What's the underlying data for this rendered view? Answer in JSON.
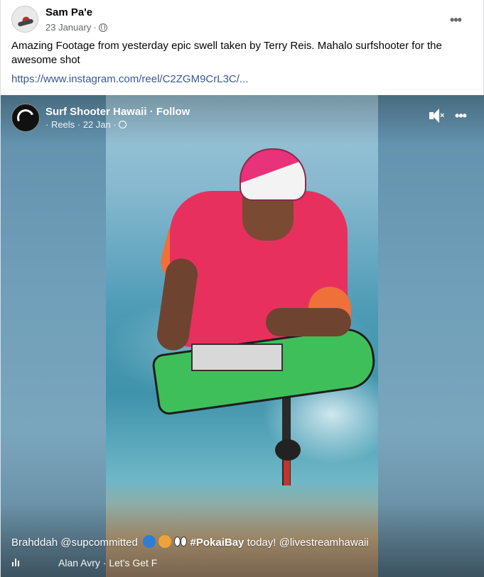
{
  "post": {
    "author": "Sam Pa'e",
    "date": "23 January",
    "privacy_icon": "globe-icon",
    "caption": "Amazing Footage from yesterday epic swell taken by Terry Reis. Mahalo surfshooter for the awesome shot",
    "link": "https://www.instagram.com/reel/C2ZGM9CrL3C/...",
    "more_icon": "•••"
  },
  "reel": {
    "page_name": "Surf Shooter Hawaii · Follow",
    "meta": "· Reels · 22 Jan ·",
    "mute_icon": "speaker-muted-icon",
    "more_icon": "•••",
    "caption_prefix": "Brahddah @supcommitted ",
    "hashtag": "#PokaiBay",
    "caption_suffix": " today! @livestreamhawaii",
    "audio_text": "Alan Avry · Let's Get F"
  }
}
